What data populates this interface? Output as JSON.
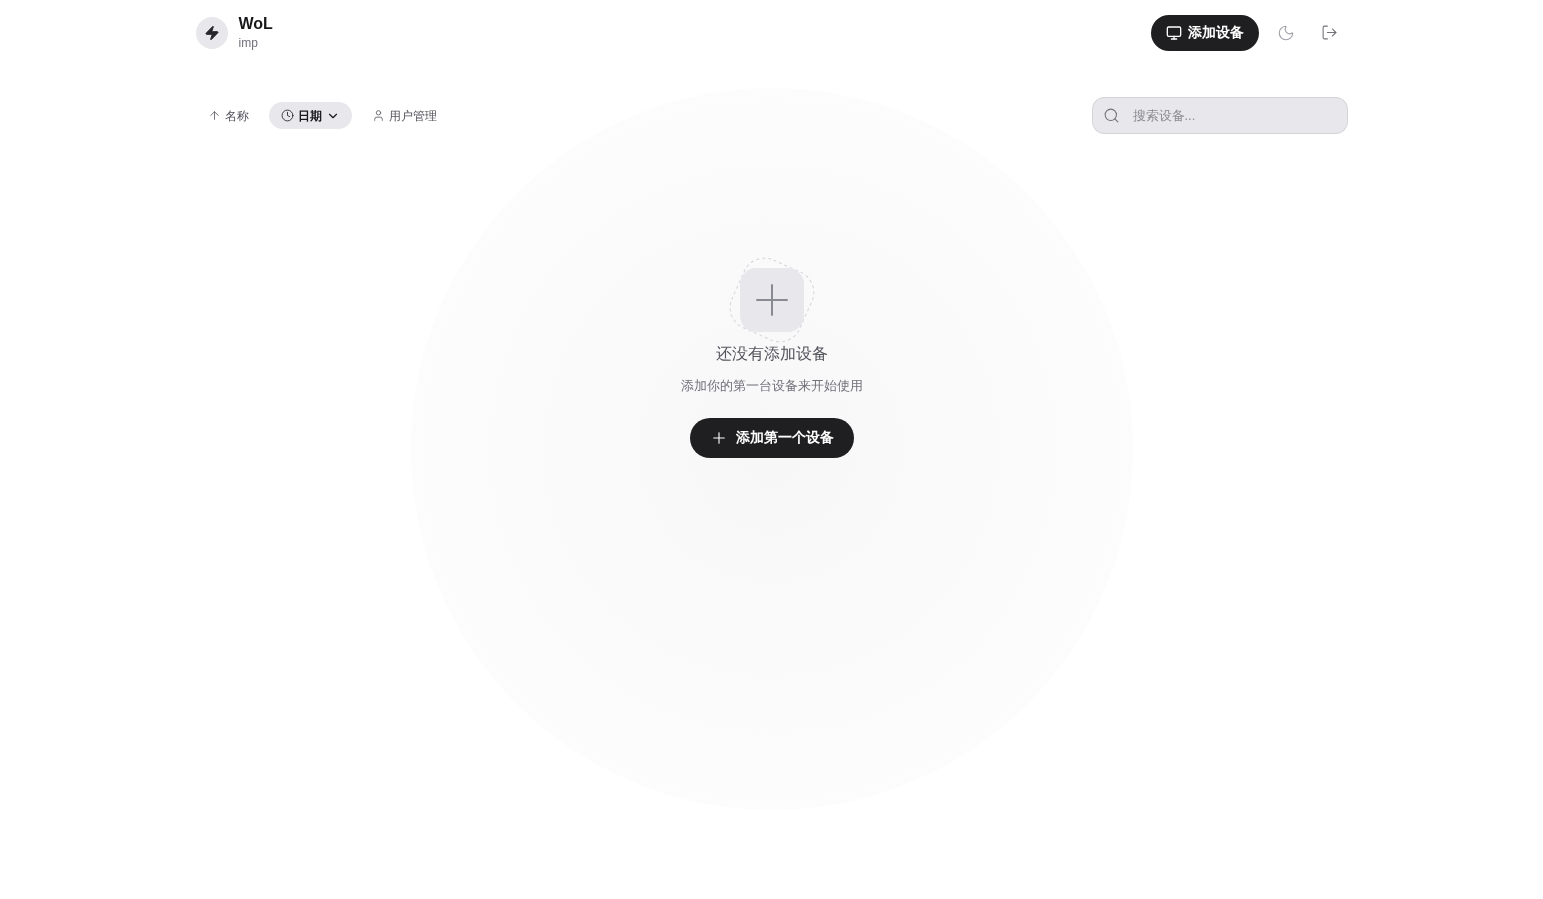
{
  "header": {
    "app_name": "WoL",
    "user": "imp",
    "add_button": "添加设备"
  },
  "toolbar": {
    "sort_options": [
      {
        "kind": "name",
        "label": "名称",
        "selected": false
      },
      {
        "kind": "date",
        "label": "日期",
        "selected": true
      }
    ],
    "nav_link": "用户管理"
  },
  "search": {
    "placeholder": "搜索设备..."
  },
  "empty_state": {
    "title": "还没有添加设备",
    "subtitle": "添加你的第一台设备来开始使用",
    "button": "添加第一个设备"
  }
}
